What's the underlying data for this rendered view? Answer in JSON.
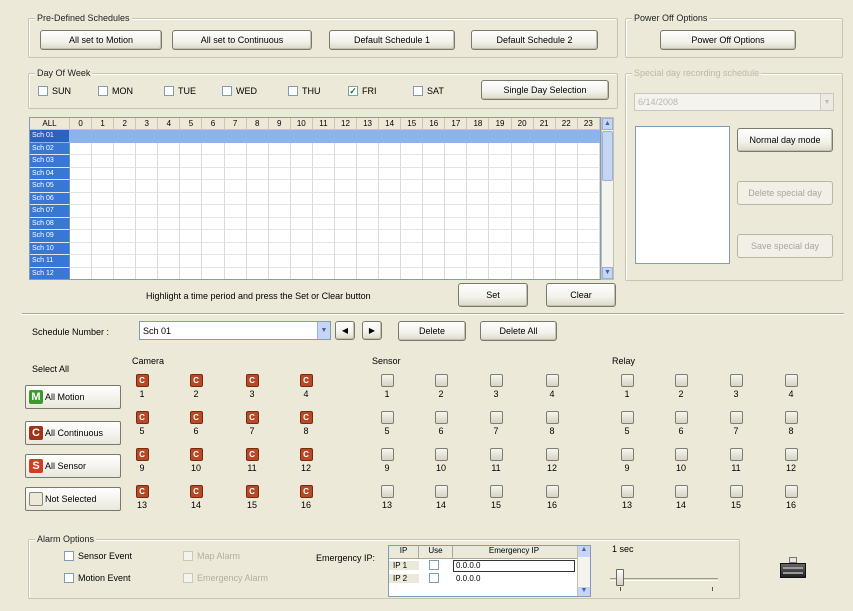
{
  "predefined": {
    "title": "Pre-Defined Schedules",
    "buttons": [
      "All set to Motion",
      "All set to Continuous",
      "Default Schedule 1",
      "Default Schedule 2"
    ]
  },
  "power": {
    "title": "Power Off Options",
    "button": "Power Off Options"
  },
  "dow": {
    "title": "Day Of Week",
    "days": [
      {
        "label": "SUN",
        "checked": false
      },
      {
        "label": "MON",
        "checked": false
      },
      {
        "label": "TUE",
        "checked": false
      },
      {
        "label": "WED",
        "checked": false
      },
      {
        "label": "THU",
        "checked": false
      },
      {
        "label": "FRI",
        "checked": true
      },
      {
        "label": "SAT",
        "checked": false
      }
    ],
    "single_day_button": "Single Day Selection"
  },
  "special": {
    "title": "Special day recording schedule",
    "date": "6/14/2008",
    "normal": "Normal day mode",
    "delete": "Delete special day",
    "save": "Save special day"
  },
  "grid": {
    "corner": "ALL",
    "hours": [
      "0",
      "1",
      "2",
      "3",
      "4",
      "5",
      "6",
      "7",
      "8",
      "9",
      "10",
      "11",
      "12",
      "13",
      "14",
      "15",
      "16",
      "17",
      "18",
      "19",
      "20",
      "21",
      "22",
      "23"
    ],
    "rows": [
      "Sch 01",
      "Sch 02",
      "Sch 03",
      "Sch 04",
      "Sch 05",
      "Sch 06",
      "Sch 07",
      "Sch 08",
      "Sch 09",
      "Sch 10",
      "Sch 11",
      "Sch 12"
    ],
    "selected_row": 0
  },
  "hint": "Highlight a time period and press the Set or Clear button",
  "set": "Set",
  "clear": "Clear",
  "schedule": {
    "label": "Schedule Number :",
    "value": "Sch 01",
    "prev": "◀",
    "next": "▶",
    "delete": "Delete",
    "delete_all": "Delete All"
  },
  "select_all": {
    "title": "Select All",
    "buttons": [
      {
        "letter": "M",
        "label": "All Motion",
        "color": "#3a9a2c"
      },
      {
        "letter": "C",
        "label": "All Continuous",
        "color": "#9e3517"
      },
      {
        "letter": "S",
        "label": "All Sensor",
        "color": "#d43b20"
      },
      {
        "letter": "",
        "label": "Not Selected",
        "color": "#ece9d8"
      }
    ]
  },
  "camera": {
    "title": "Camera",
    "icon_letter": "C",
    "numbers": [
      "1",
      "2",
      "3",
      "4",
      "5",
      "6",
      "7",
      "8",
      "9",
      "10",
      "11",
      "12",
      "13",
      "14",
      "15",
      "16"
    ]
  },
  "sensor": {
    "title": "Sensor",
    "numbers": [
      "1",
      "2",
      "3",
      "4",
      "5",
      "6",
      "7",
      "8",
      "9",
      "10",
      "11",
      "12",
      "13",
      "14",
      "15",
      "16"
    ]
  },
  "relay": {
    "title": "Relay",
    "numbers": [
      "1",
      "2",
      "3",
      "4",
      "5",
      "6",
      "7",
      "8",
      "9",
      "10",
      "11",
      "12",
      "13",
      "14",
      "15",
      "16"
    ]
  },
  "alarm": {
    "title": "Alarm Options",
    "sensor_event": "Sensor Event",
    "motion_event": "Motion Event",
    "map_alarm": "Map Alarm",
    "emergency_alarm": "Emergency Alarm",
    "emergency_ip_label": "Emergency IP:",
    "table": {
      "headers": [
        "IP",
        "Use",
        "Emergency IP"
      ],
      "rows": [
        {
          "ip": "IP 1",
          "value": "0.0.0.0"
        },
        {
          "ip": "IP 2",
          "value": "0.0.0.0"
        }
      ]
    },
    "duration": "1 sec"
  }
}
